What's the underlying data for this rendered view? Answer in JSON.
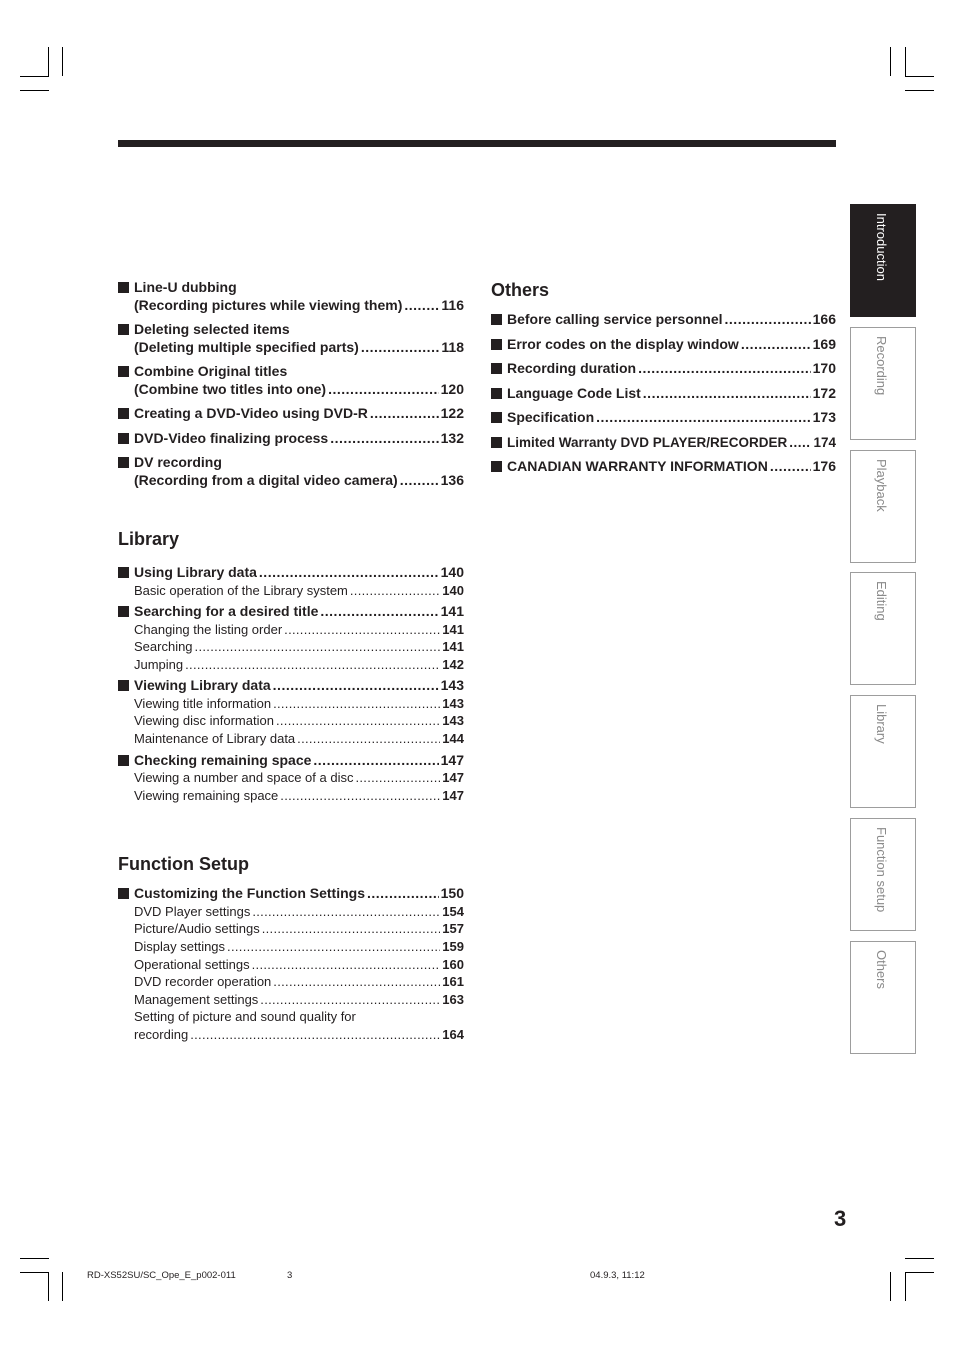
{
  "left_top_entries": [
    {
      "title": "Line-U dubbing",
      "line2": "(Recording pictures while viewing them)",
      "page": "116"
    },
    {
      "title": "Deleting selected items",
      "line2": "(Deleting multiple specified parts)",
      "page": "118"
    },
    {
      "title": "Combine Original titles",
      "line2": "(Combine two titles into one)",
      "page": "120"
    },
    {
      "title": "Creating a DVD-Video using DVD-R",
      "page": "122"
    },
    {
      "title": "DVD-Video finalizing process",
      "page": "132"
    },
    {
      "title": "DV recording",
      "line2": "(Recording from a digital video camera)",
      "page": "136"
    }
  ],
  "library": {
    "title": "Library",
    "entries": [
      {
        "title": "Using Library data",
        "page": "140",
        "subs": [
          {
            "title": "Basic operation of the Library system",
            "page": "140"
          }
        ]
      },
      {
        "title": "Searching for a desired title",
        "page": "141",
        "subs": [
          {
            "title": "Changing the listing order",
            "page": "141"
          },
          {
            "title": "Searching",
            "page": "141"
          },
          {
            "title": "Jumping",
            "page": "142"
          }
        ]
      },
      {
        "title": "Viewing Library data",
        "page": "143",
        "subs": [
          {
            "title": "Viewing title information",
            "page": "143"
          },
          {
            "title": "Viewing disc information",
            "page": "143"
          },
          {
            "title": "Maintenance of Library data",
            "page": "144"
          }
        ]
      },
      {
        "title": "Checking remaining space",
        "page": "147",
        "subs": [
          {
            "title": "Viewing a number and space of a disc",
            "page": "147"
          },
          {
            "title": "Viewing remaining space",
            "page": "147"
          }
        ]
      }
    ]
  },
  "function_setup": {
    "title": "Function Setup",
    "entries": [
      {
        "title": "Customizing the Function Settings",
        "page": "150",
        "subs": [
          {
            "title": "DVD Player settings",
            "page": "154"
          },
          {
            "title": "Picture/Audio settings",
            "page": "157"
          },
          {
            "title": "Display settings",
            "page": "159"
          },
          {
            "title": "Operational settings",
            "page": "160"
          },
          {
            "title": "DVD recorder operation",
            "page": "161"
          },
          {
            "title": "Management settings",
            "page": "163"
          }
        ],
        "last_sub": {
          "line1": "Setting of picture and sound quality for",
          "line2": "recording",
          "page": "164"
        }
      }
    ]
  },
  "others": {
    "title": "Others",
    "entries": [
      {
        "title": "Before calling service personnel",
        "page": "166"
      },
      {
        "title": "Error codes on the display window",
        "page": "169"
      },
      {
        "title": "Recording duration",
        "page": "170"
      },
      {
        "title": "Language Code List",
        "page": "172"
      },
      {
        "title": "Specification",
        "page": "173"
      },
      {
        "title": "Limited Warranty DVD PLAYER/RECORDER",
        "page": "174"
      },
      {
        "title": "CANADIAN WARRANTY INFORMATION",
        "page": "176"
      }
    ]
  },
  "side_tabs": [
    {
      "label": "Introduction",
      "active": true
    },
    {
      "label": "Recording",
      "active": false
    },
    {
      "label": "Playback",
      "active": false
    },
    {
      "label": "Editing",
      "active": false
    },
    {
      "label": "Library",
      "active": false
    },
    {
      "label": "Function setup",
      "active": false
    },
    {
      "label": "Others",
      "active": false
    }
  ],
  "page_number": "3",
  "footer": {
    "file": "RD-XS52SU/SC_Ope_E_p002-011",
    "page": "3",
    "timestamp": "04.9.3, 11:12"
  },
  "colors": {
    "text": "#231f20",
    "tab_border": "#9d9d9d",
    "tab_text": "#8a8a8a"
  }
}
